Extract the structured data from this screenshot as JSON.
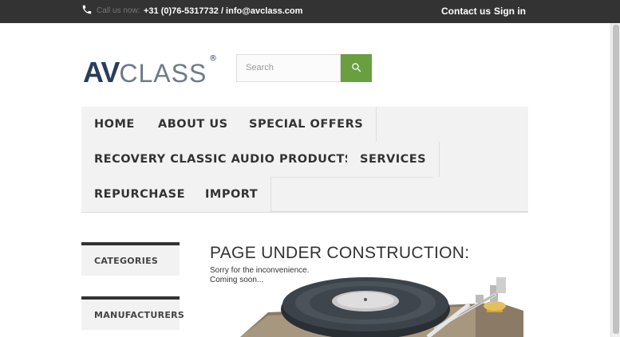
{
  "topbar": {
    "call_label": "Call us now:",
    "contact_line": "+31 (0)76-5317732 / info@avclass.com",
    "contact_us": "Contact us",
    "sign_in": "Sign in"
  },
  "logo": {
    "av": "AV",
    "class": "CLASS",
    "reg": "®"
  },
  "search": {
    "placeholder": "Search",
    "button_icon": "search-icon"
  },
  "nav": {
    "items": [
      "HOME",
      "ABOUT US",
      "SPECIAL OFFERS",
      "RECOVERY CLASSIC AUDIO PRODUCTS",
      "SERVICES",
      "REPURCHASE",
      "IMPORT"
    ]
  },
  "sidebar": {
    "categories": "CATEGORIES",
    "manufacturers": "MANUFACTURERS"
  },
  "main": {
    "title": "PAGE UNDER CONSTRUCTION:",
    "line1": "Sorry for the inconvenience.",
    "line2": "Coming soon..."
  },
  "colors": {
    "topbar": "#333333",
    "accent_green": "#699f3f",
    "logo_dark": "#2b3d5c",
    "nav_bg": "#f2f2f2"
  }
}
